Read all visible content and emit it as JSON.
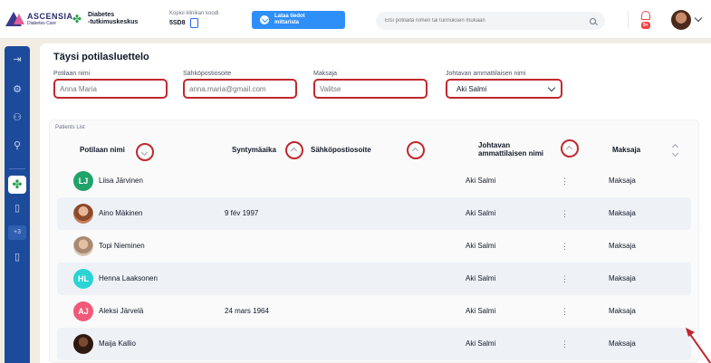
{
  "header": {
    "logo_name": "ASCENSIA",
    "logo_sub": "Diabetes Care",
    "clinic_name_line1": "Diabetes",
    "clinic_name_line2": "-tutkimuskeskus",
    "copy_code_label": "Kopioi klinikan koodi",
    "copy_code_value": "5SD8",
    "download_line1": "Lataa tiedot",
    "download_line2": "mittarista",
    "search_placeholder": "Etsi potilaita nimen tai tunnuksen mukaan",
    "notification_badge": "9+"
  },
  "sidebar": {
    "items": [
      "logout-icon",
      "settings-icon",
      "users-icon",
      "user-settings-icon",
      "clinic-clover-icon",
      "document-icon",
      "plus-count",
      "document-icon"
    ],
    "plus_label": "+3"
  },
  "page": {
    "title": "Täysi potilasluettelo"
  },
  "filters": {
    "patient_name_label": "Potilaan nimi",
    "patient_name_placeholder": "Anna Maria",
    "email_label": "Sähköpostiosoite",
    "email_placeholder": "anna.maria@gmail.com",
    "payer_label": "Maksaja",
    "payer_placeholder": "Valitse",
    "professional_label": "Johtavan ammattilaisen nimi",
    "professional_value": "Aki Salmi"
  },
  "list": {
    "title": "Patients List",
    "columns": {
      "name": "Potilaan nimi",
      "birthday": "Syntymäaika",
      "email": "Sähköpostiosoite",
      "professional_line1": "Johtavan",
      "professional_line2": "ammattilaisen nimi",
      "payer": "Maksaja"
    },
    "rows": [
      {
        "initials": "LJ",
        "avatar_color": "#1fa36a",
        "name": "Liisa Järvinen",
        "birthday": "",
        "email": "",
        "professional": "Aki Salmi",
        "payer": "Maksaja"
      },
      {
        "initials": "",
        "avatar_color": "photo-a",
        "name": "Aino Mäkinen",
        "birthday": "9 fév 1997",
        "email": "",
        "professional": "Aki Salmi",
        "payer": "Maksaja"
      },
      {
        "initials": "",
        "avatar_color": "photo-b",
        "name": "Topi Nieminen",
        "birthday": "",
        "email": "",
        "professional": "Aki Salmi",
        "payer": "Maksaja"
      },
      {
        "initials": "HL",
        "avatar_color": "#2ad4d4",
        "name": "Henna Laaksonen",
        "birthday": "",
        "email": "",
        "professional": "Aki Salmi",
        "payer": "Maksaja"
      },
      {
        "initials": "AJ",
        "avatar_color": "#f05a78",
        "name": "Aleksi Järvelä",
        "birthday": "24 mars 1964",
        "email": "",
        "professional": "Aki Salmi",
        "payer": "Maksaja"
      },
      {
        "initials": "",
        "avatar_color": "photo-c",
        "name": "Maija Kallio",
        "birthday": "",
        "email": "",
        "professional": "Aki Salmi",
        "payer": "Maksaja"
      }
    ]
  },
  "colors": {
    "accent": "#2f8ff8",
    "sidebar": "#1d4b9b",
    "highlight": "#c0282d",
    "row_alt": "#eef2f7"
  }
}
